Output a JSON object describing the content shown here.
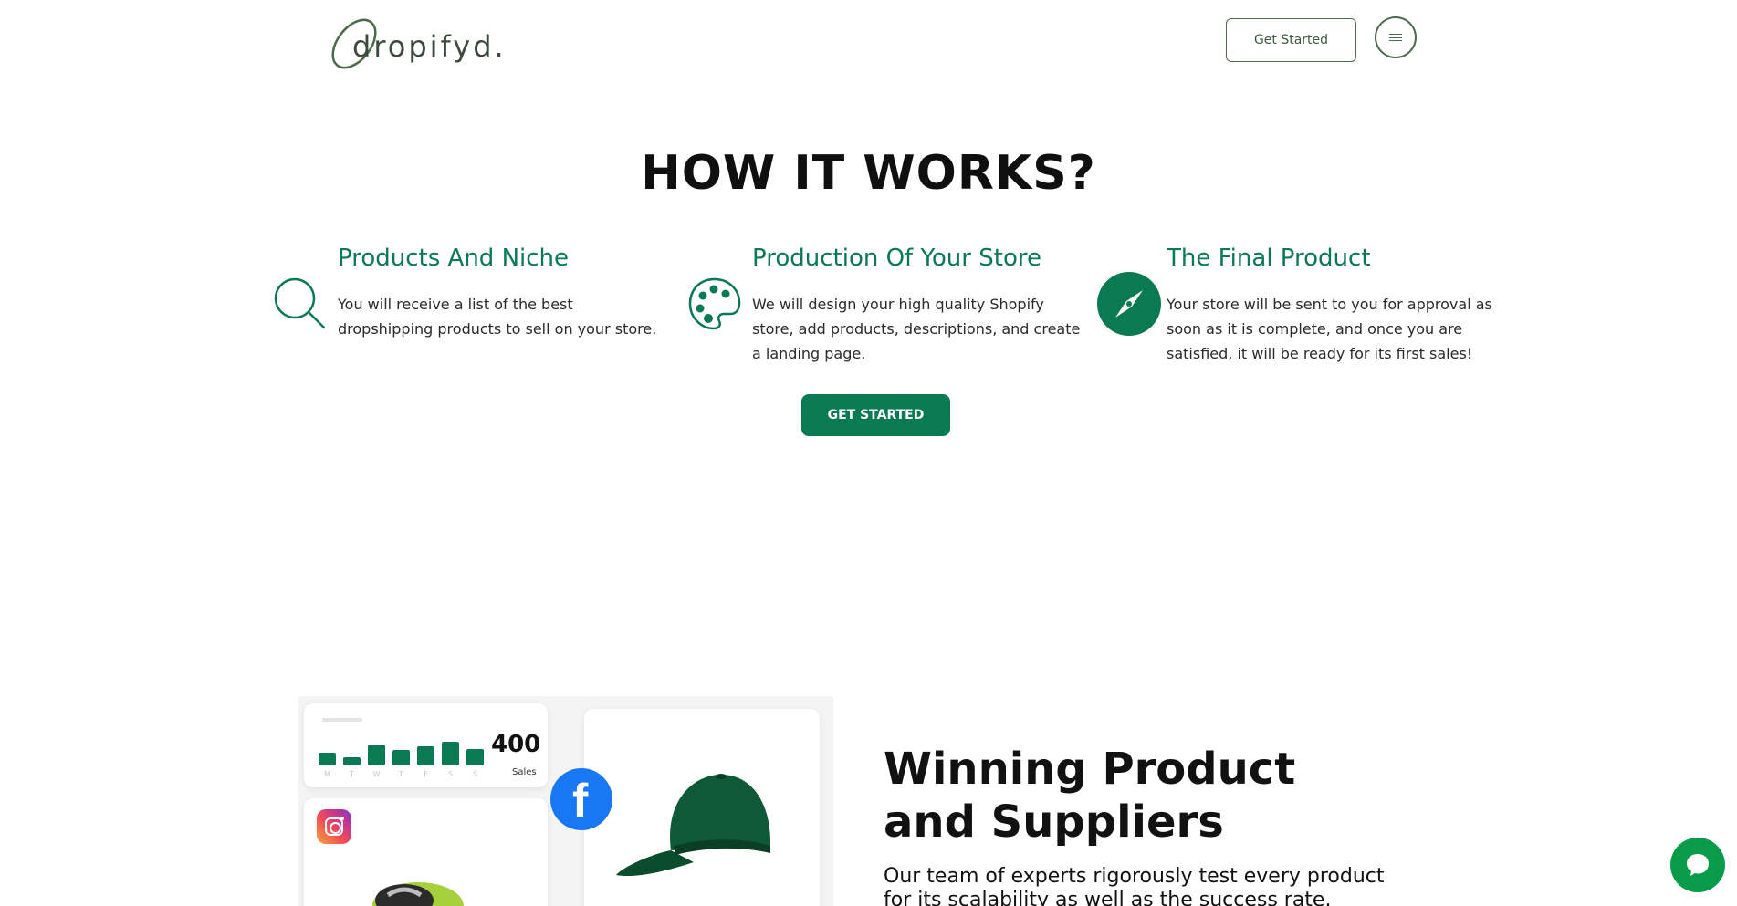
{
  "header": {
    "logo_text": "dropifyd.",
    "get_started_label": "Get Started",
    "menu_icon": "hamburger-icon"
  },
  "how_it_works": {
    "title": "HOW IT WORKS?",
    "steps": [
      {
        "icon": "search-icon",
        "title": "Products And Niche",
        "description": "You will receive a list of the best dropshipping products to sell on your store."
      },
      {
        "icon": "palette-icon",
        "title": "Production Of Your Store",
        "description": "We will design your high quality Shopify store, add products, descriptions, and create a landing page."
      },
      {
        "icon": "compass-icon",
        "title": "The Final Product",
        "description": "Your store will be sent to you for approval as soon as it is complete, and once you are satisfied, it will be ready for its first sales!"
      }
    ],
    "cta_label": "GET STARTED"
  },
  "winning": {
    "title": "Winning Product and Suppliers",
    "description": "Our team of experts rigorously test every product for its scalability as well as the success rate.",
    "sales_card": {
      "value": "400",
      "label": "Sales",
      "days": [
        "M",
        "T",
        "W",
        "T",
        "F",
        "S",
        "S"
      ],
      "bar_levels": [
        0.45,
        0.3,
        0.75,
        0.55,
        0.7,
        0.85,
        0.6
      ]
    },
    "social_icons": [
      "instagram-icon",
      "facebook-icon"
    ]
  },
  "chat": {
    "icon": "chat-icon"
  },
  "colors": {
    "brand_green": "#0a7a52",
    "logo_green": "#4d6a4f",
    "facebook_blue": "#1877f2",
    "chat_green": "#0a9b4a"
  }
}
